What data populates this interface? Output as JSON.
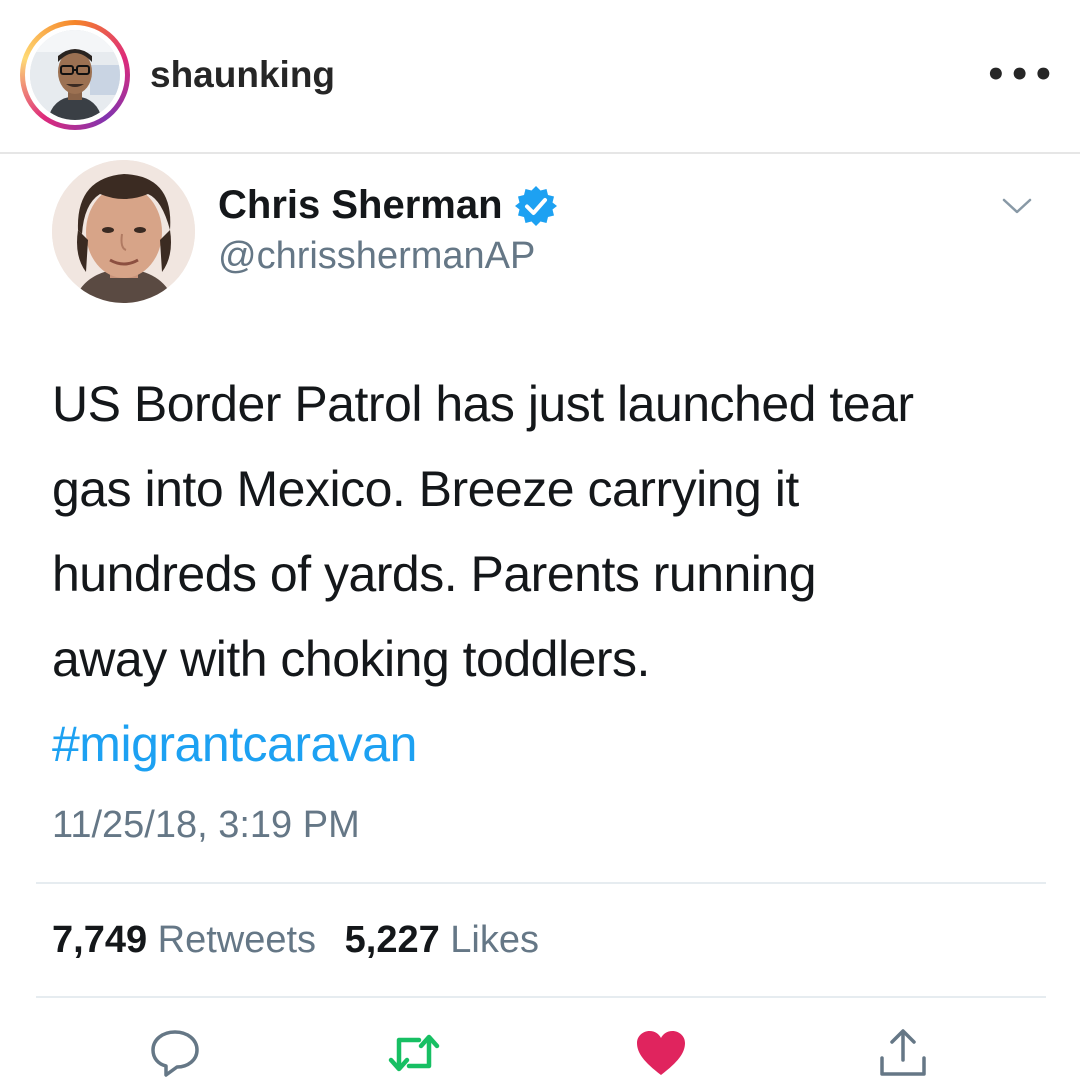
{
  "instagram": {
    "username": "shaunking",
    "more_label": "•••",
    "ring_colors": [
      "#f58529",
      "#dd2a7b",
      "#8134af",
      "#feda75"
    ]
  },
  "tweet": {
    "author_name": "Chris Sherman",
    "handle": "@chrisshermanAP",
    "verified": true,
    "text_lines": [
      "US Border Patrol has just launched tear",
      "gas into Mexico. Breeze carrying it",
      "hundreds of yards. Parents running",
      "away with choking toddlers."
    ],
    "hashtag": "#migrantcaravan",
    "timestamp": "11/25/18, 3:19 PM",
    "stats": {
      "retweets_count": "7,749",
      "retweets_label": "Retweets",
      "likes_count": "5,227",
      "likes_label": "Likes"
    },
    "actions": {
      "reply_icon": "reply-icon",
      "retweet_icon": "retweet-icon",
      "like_icon": "heart-icon",
      "share_icon": "share-icon"
    }
  },
  "colors": {
    "text_primary": "#14171a",
    "text_secondary": "#657786",
    "link_blue": "#1da1f2",
    "retweet_green": "#17bf63",
    "like_red": "#e0245e",
    "verified_blue": "#1da1f2"
  }
}
